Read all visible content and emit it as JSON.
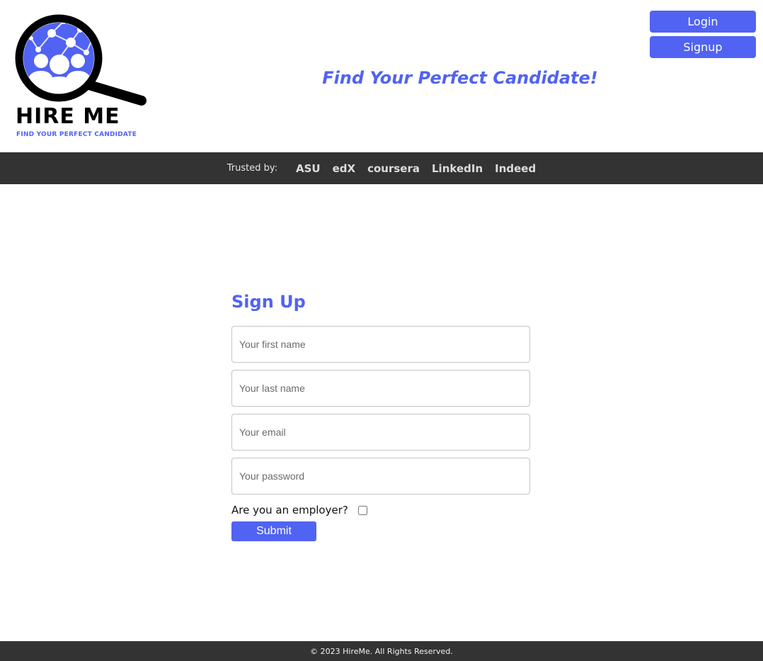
{
  "colors": {
    "accent": "#5163f2",
    "dark_bar": "#333333",
    "white": "#ffffff"
  },
  "header": {
    "logo_title": "HIRE ME",
    "logo_tagline": "FIND YOUR PERFECT CANDIDATE",
    "hero_text": "Find Your Perfect Candidate!",
    "login_label": "Login",
    "signup_label": "Signup",
    "logo_icon": "magnifier-people-network-icon"
  },
  "trusted": {
    "label": "Trusted by:",
    "items": [
      "ASU",
      "edX",
      "coursera",
      "LinkedIn",
      "Indeed"
    ]
  },
  "signup_form": {
    "title": "Sign Up",
    "first_name_placeholder": "Your first name",
    "first_name_value": "",
    "last_name_placeholder": "Your last name",
    "last_name_value": "",
    "email_placeholder": "Your email",
    "email_value": "",
    "password_placeholder": "Your password",
    "password_value": "",
    "employer_label": "Are you an employer?",
    "employer_checked": false,
    "submit_label": "Submit"
  },
  "footer": {
    "text": "© 2023 HireMe. All Rights Reserved."
  }
}
